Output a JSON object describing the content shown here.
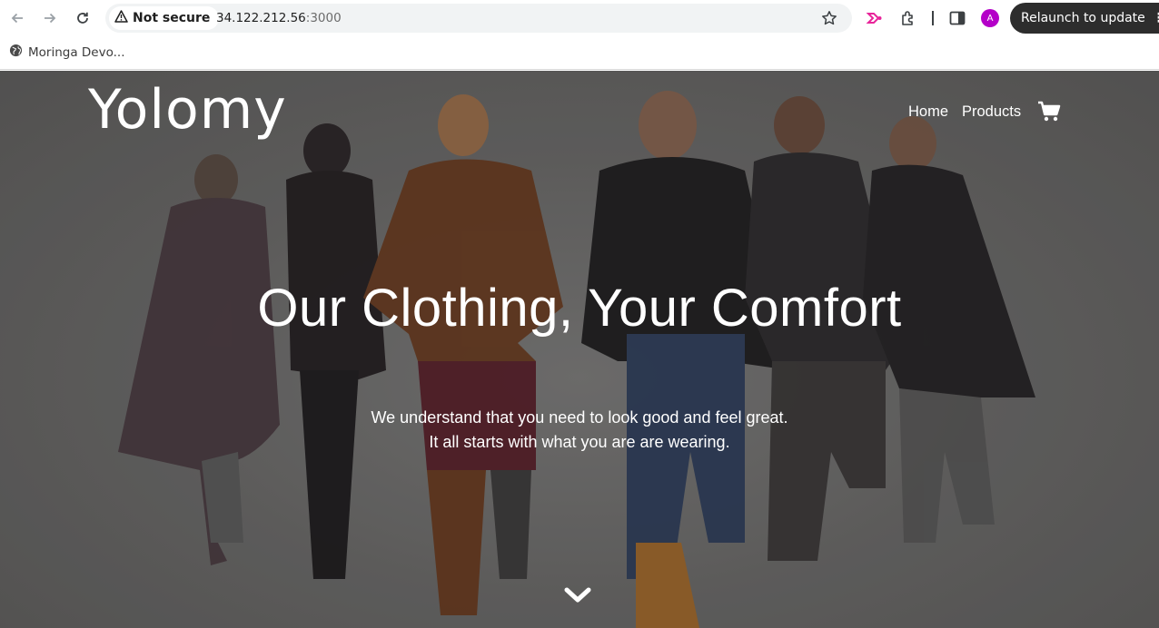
{
  "browser": {
    "security_label": "Not secure",
    "url_host": "34.122.212.56",
    "url_port": ":3000",
    "profile_initial": "A",
    "relaunch_label": "Relaunch to update",
    "bookmarks": [
      {
        "label": "Moringa Devo...",
        "icon": "globe-icon"
      }
    ]
  },
  "site": {
    "brand": "Yolomy",
    "nav": {
      "home": "Home",
      "products": "Products"
    },
    "hero": {
      "headline": "Our Clothing, Your Comfort",
      "tagline_line1": "We understand that you need to look good and feel great.",
      "tagline_line2": "It all starts with what you are are wearing."
    }
  },
  "icons": {
    "back": "arrow-left-icon",
    "forward": "arrow-right-icon",
    "reload": "reload-icon",
    "warning": "warning-triangle-icon",
    "star": "star-icon",
    "extension_pink": "arrow-extension-icon",
    "puzzle": "puzzle-icon",
    "side_panel": "side-panel-icon",
    "cart": "shopping-cart-icon",
    "scroll": "chevron-down-icon"
  },
  "colors": {
    "profile_avatar": "#b400c8",
    "extension_accent": "#e8249a",
    "relaunch_bg": "#2d2d2d",
    "hero_text": "#ffffff"
  }
}
